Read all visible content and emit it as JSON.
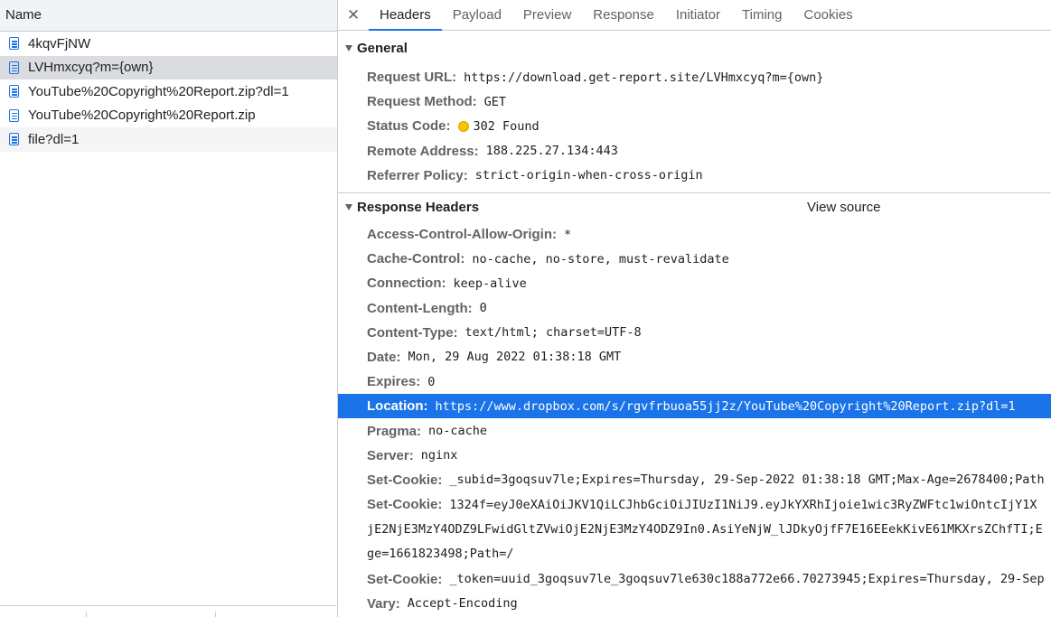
{
  "request_list": {
    "column_header": "Name",
    "items": [
      {
        "name": "4kqvFjNW"
      },
      {
        "name": "LVHmxcyq?m={own}"
      },
      {
        "name": "YouTube%20Copyright%20Report.zip?dl=1"
      },
      {
        "name": "YouTube%20Copyright%20Report.zip"
      },
      {
        "name": "file?dl=1"
      }
    ]
  },
  "tabs": {
    "close_glyph": "✕",
    "items": [
      "Headers",
      "Payload",
      "Preview",
      "Response",
      "Initiator",
      "Timing",
      "Cookies"
    ],
    "active": "Headers"
  },
  "general": {
    "title": "General",
    "rows": [
      {
        "key": "Request URL:",
        "value": "https://download.get-report.site/LVHmxcyq?m={own}"
      },
      {
        "key": "Request Method:",
        "value": "GET"
      },
      {
        "key": "Status Code:",
        "value": "302 Found",
        "status_color": "#f9c300"
      },
      {
        "key": "Remote Address:",
        "value": "188.225.27.134:443"
      },
      {
        "key": "Referrer Policy:",
        "value": "strict-origin-when-cross-origin"
      }
    ]
  },
  "response_headers": {
    "title": "Response Headers",
    "view_source": "View source",
    "rows": [
      {
        "key": "Access-Control-Allow-Origin:",
        "value": "*"
      },
      {
        "key": "Cache-Control:",
        "value": "no-cache, no-store, must-revalidate"
      },
      {
        "key": "Connection:",
        "value": "keep-alive"
      },
      {
        "key": "Content-Length:",
        "value": "0"
      },
      {
        "key": "Content-Type:",
        "value": "text/html; charset=UTF-8"
      },
      {
        "key": "Date:",
        "value": "Mon, 29 Aug 2022 01:38:18 GMT"
      },
      {
        "key": "Expires:",
        "value": "0"
      },
      {
        "key": "Location:",
        "value": "https://www.dropbox.com/s/rgvfrbuoa55jj2z/YouTube%20Copyright%20Report.zip?dl=1"
      },
      {
        "key": "Pragma:",
        "value": "no-cache"
      },
      {
        "key": "Server:",
        "value": "nginx"
      },
      {
        "key": "Set-Cookie:",
        "value": "_subid=3goqsuv7le;Expires=Thursday, 29-Sep-2022 01:38:18 GMT;Max-Age=2678400;Path"
      },
      {
        "key": "Set-Cookie:",
        "value_lines": [
          "1324f=eyJ0eXAiOiJKV1QiLCJhbGciOiJIUzI1NiJ9.eyJkYXRhIjoie1wic3RyZWFtc1wiOntcIjY1X",
          "jE2NjE3MzY4ODZ9LFwidGltZVwiOjE2NjE3MzY4ODZ9In0.AsiYeNjW_lJDkyOjfF7E16EEekKivE61MKXrsZChfTI;E",
          "ge=1661823498;Path=/"
        ]
      },
      {
        "key": "Set-Cookie:",
        "value": "_token=uuid_3goqsuv7le_3goqsuv7le630c188a772e66.70273945;Expires=Thursday, 29-Sep"
      },
      {
        "key": "Vary:",
        "value": "Accept-Encoding"
      }
    ]
  },
  "colors": {
    "accent": "#1a73e8",
    "selection": "#1a73e8",
    "status_warning": "#f9c300"
  }
}
